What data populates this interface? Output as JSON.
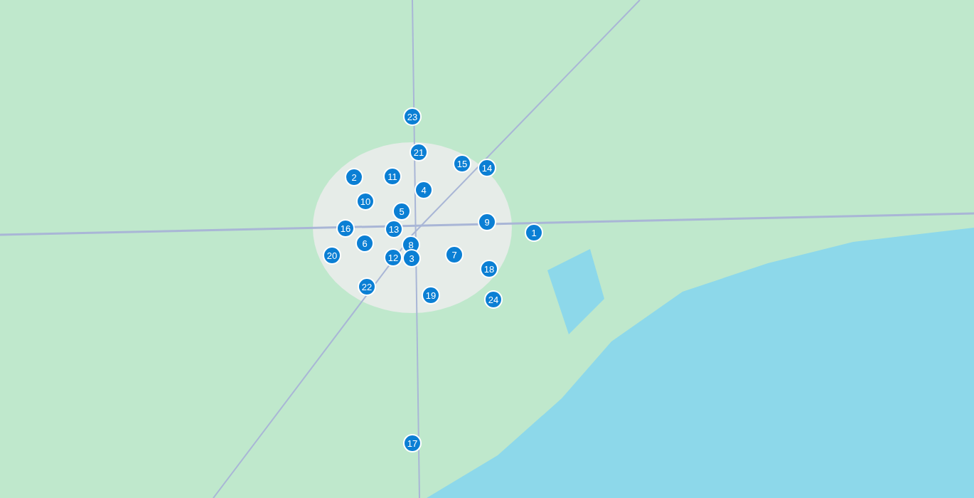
{
  "map": {
    "markers": [
      {
        "label": "23"
      },
      {
        "label": "21"
      },
      {
        "label": "15"
      },
      {
        "label": "14"
      },
      {
        "label": "11"
      },
      {
        "label": "2"
      },
      {
        "label": "4"
      },
      {
        "label": "10"
      },
      {
        "label": "5"
      },
      {
        "label": "9"
      },
      {
        "label": "16"
      },
      {
        "label": "13"
      },
      {
        "label": "1"
      },
      {
        "label": "6"
      },
      {
        "label": "8"
      },
      {
        "label": "20"
      },
      {
        "label": "12"
      },
      {
        "label": "3"
      },
      {
        "label": "7"
      },
      {
        "label": "18"
      },
      {
        "label": "22"
      },
      {
        "label": "19"
      },
      {
        "label": "24"
      },
      {
        "label": "17"
      }
    ]
  }
}
